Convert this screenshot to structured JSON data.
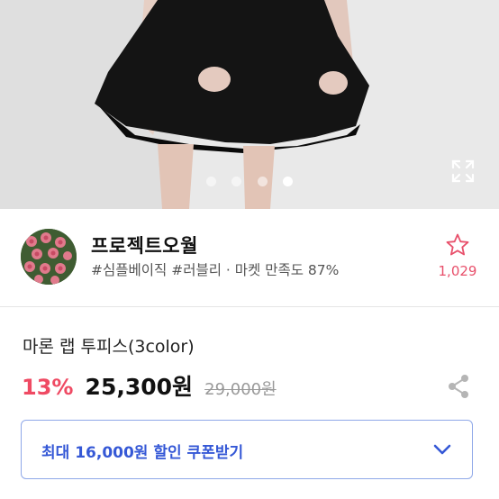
{
  "gallery": {
    "dots": [
      {
        "active": false
      },
      {
        "active": false
      },
      {
        "active": false
      },
      {
        "active": true
      }
    ],
    "expand_icon": "expand-icon"
  },
  "store": {
    "name": "프로젝트오월",
    "tags": "#심플베이직 #러블리 · 마켓 만족도 87%",
    "favorite_count": "1,029",
    "favorite_icon": "star-outline-icon"
  },
  "product": {
    "title": "마론 랩 투피스(3color)",
    "discount": "13%",
    "price": "25,300원",
    "original_price": "29,000원",
    "share_icon": "share-icon"
  },
  "coupon": {
    "label": "최대 16,000원 할인 쿠폰받기",
    "chevron_icon": "chevron-down-icon"
  },
  "colors": {
    "accent_red": "#ef4a63",
    "coupon_blue": "#3558d6",
    "coupon_border": "#8fa8e8"
  }
}
